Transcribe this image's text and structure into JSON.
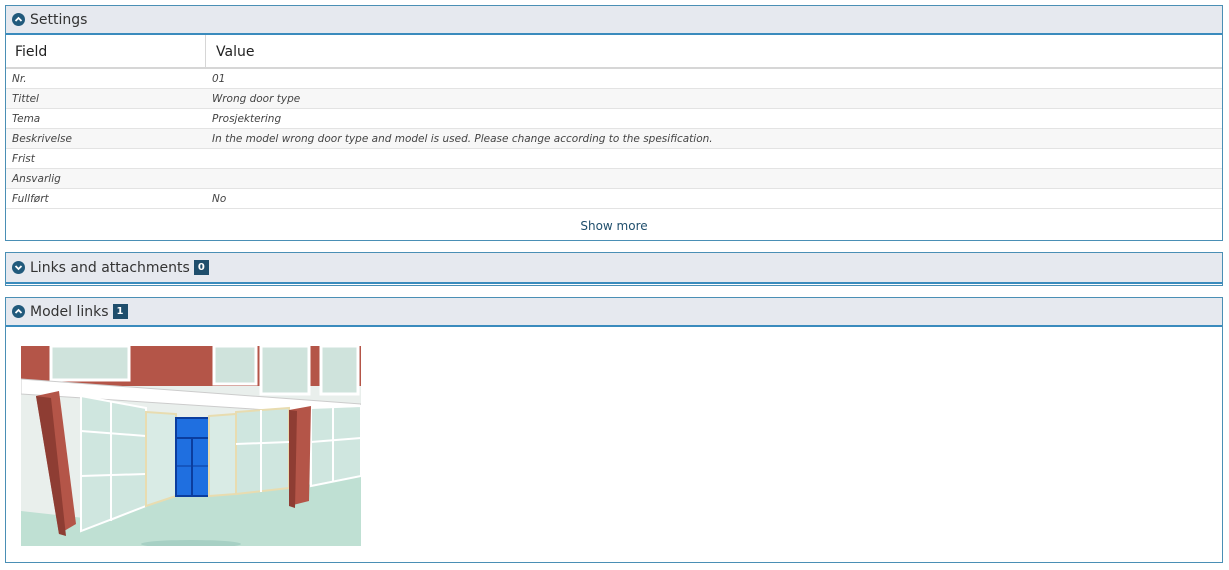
{
  "settings": {
    "title": "Settings",
    "col_field": "Field",
    "col_value": "Value",
    "rows": [
      {
        "field": "Nr.",
        "value": "01"
      },
      {
        "field": "Tittel",
        "value": "Wrong door type"
      },
      {
        "field": "Tema",
        "value": "Prosjektering"
      },
      {
        "field": "Beskrivelse",
        "value": "In the model wrong door type and model is used. Please change according to the spesification."
      },
      {
        "field": "Frist",
        "value": ""
      },
      {
        "field": "Ansvarlig",
        "value": ""
      },
      {
        "field": "Fullført",
        "value": "No"
      }
    ],
    "show_more": "Show more"
  },
  "links": {
    "title": "Links and attachments",
    "count": "0"
  },
  "model_links": {
    "title": "Model links",
    "count": "1",
    "thumbnail_icon": "model-view-thumbnail"
  },
  "colors": {
    "header_bg": "#e6e9ef",
    "accent": "#3a8bbd",
    "badge": "#1f4e6c",
    "door": "#1f6fe0"
  }
}
